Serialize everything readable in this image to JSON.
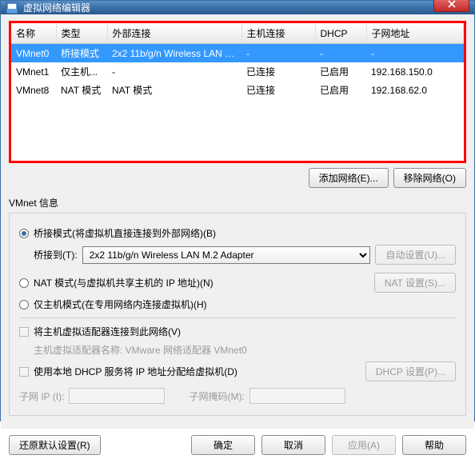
{
  "title": "虚拟网络编辑器",
  "columns": {
    "name": "名称",
    "type": "类型",
    "external": "外部连接",
    "host": "主机连接",
    "dhcp": "DHCP",
    "subnet": "子网地址"
  },
  "rows": [
    {
      "name": "VMnet0",
      "type": "桥接模式",
      "external": "2x2 11b/g/n Wireless LAN M...",
      "host": "-",
      "dhcp": "-",
      "subnet": "-"
    },
    {
      "name": "VMnet1",
      "type": "仅主机...",
      "external": "-",
      "host": "已连接",
      "dhcp": "已启用",
      "subnet": "192.168.150.0"
    },
    {
      "name": "VMnet8",
      "type": "NAT 模式",
      "external": "NAT 模式",
      "host": "已连接",
      "dhcp": "已启用",
      "subnet": "192.168.62.0"
    }
  ],
  "buttons": {
    "addNetwork": "添加网络(E)...",
    "removeNetwork": "移除网络(O)",
    "autoSettings": "自动设置(U)...",
    "natSettings": "NAT 设置(S)...",
    "dhcpSettings": "DHCP 设置(P)...",
    "restoreDefault": "还原默认设置(R)",
    "ok": "确定",
    "cancel": "取消",
    "apply": "应用(A)",
    "help": "帮助"
  },
  "vmnetInfo": {
    "groupLabel": "VMnet 信息",
    "bridgedLabel": "桥接模式(将虚拟机直接连接到外部网络)(B)",
    "bridgedToLabel": "桥接到(T):",
    "bridgedAdapter": "2x2 11b/g/n Wireless LAN M.2 Adapter",
    "natLabel": "NAT 模式(与虚拟机共享主机的 IP 地址)(N)",
    "hostOnlyLabel": "仅主机模式(在专用网络内连接虚拟机)(H)",
    "connectHostLabel": "将主机虚拟适配器连接到此网络(V)",
    "hostAdapterNameLabel": "主机虚拟适配器名称: VMware 网络适配器 VMnet0",
    "useDhcpLabel": "使用本地 DHCP 服务将 IP 地址分配给虚拟机(D)",
    "subnetIpLabel": "子网 IP (I):",
    "subnetMaskLabel": "子网掩码(M):"
  }
}
